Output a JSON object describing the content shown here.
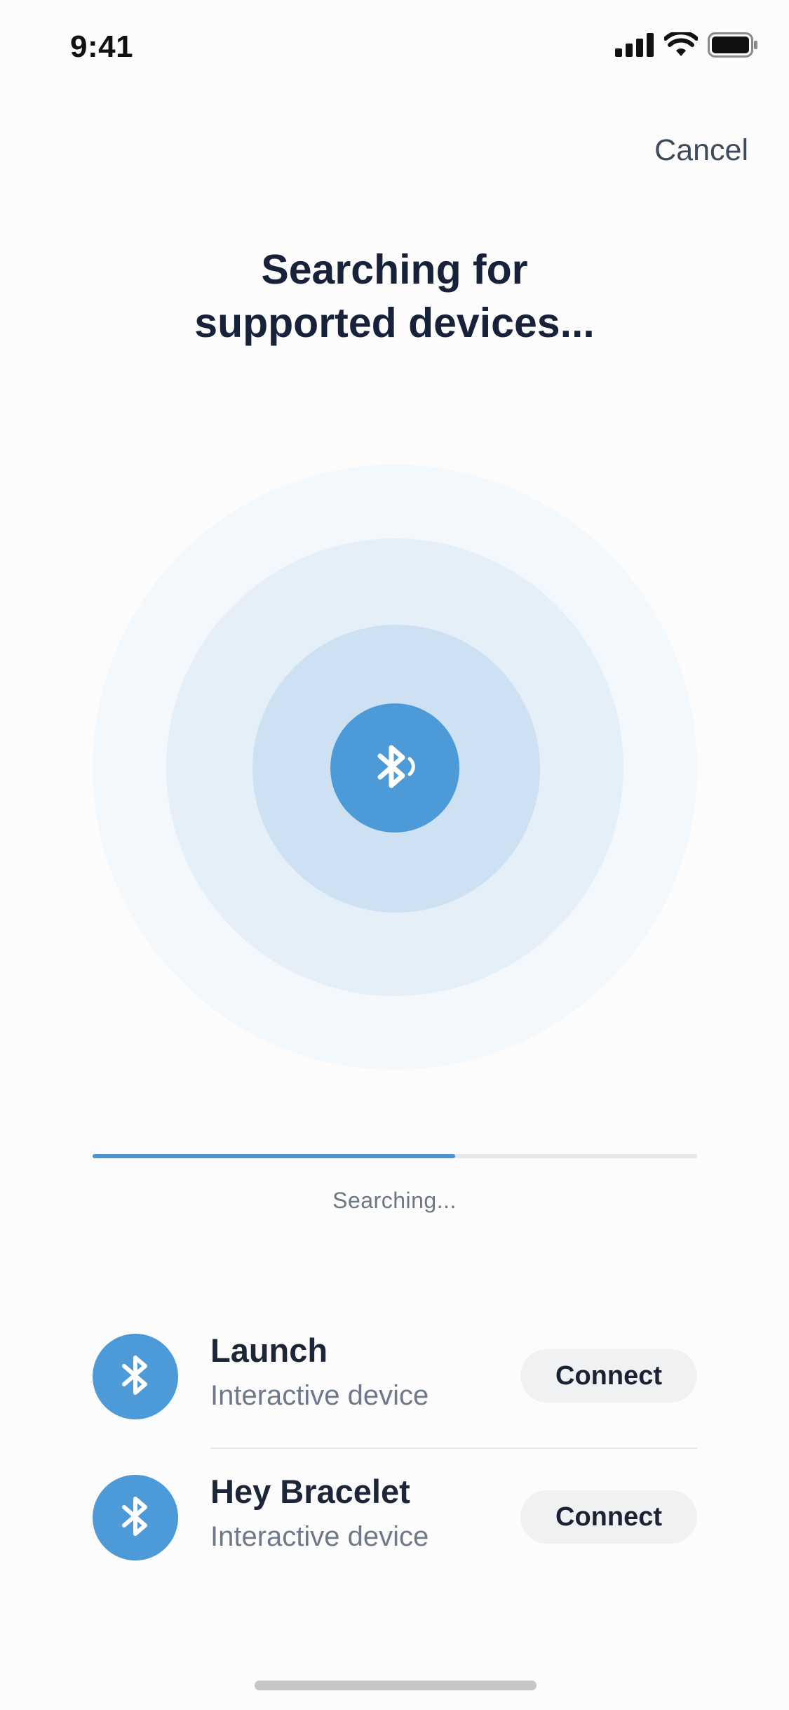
{
  "status_bar": {
    "time": "9:41",
    "icons": [
      "signal-icon",
      "wifi-icon",
      "battery-icon"
    ]
  },
  "header": {
    "cancel_label": "Cancel"
  },
  "main": {
    "title_line1": "Searching for",
    "title_line2": "supported devices...",
    "scanner_icon": "bluetooth-searching-icon",
    "progress_fraction": 0.6,
    "status_text": "Searching..."
  },
  "devices": [
    {
      "name": "Launch",
      "type": "Interactive device",
      "action_label": "Connect",
      "icon": "bluetooth-icon"
    },
    {
      "name": "Hey Bracelet",
      "type": "Interactive device",
      "action_label": "Connect",
      "icon": "bluetooth-icon"
    }
  ],
  "colors": {
    "accent": "#4d9ad8",
    "text_primary": "#17213a",
    "text_secondary": "#6e7888"
  }
}
